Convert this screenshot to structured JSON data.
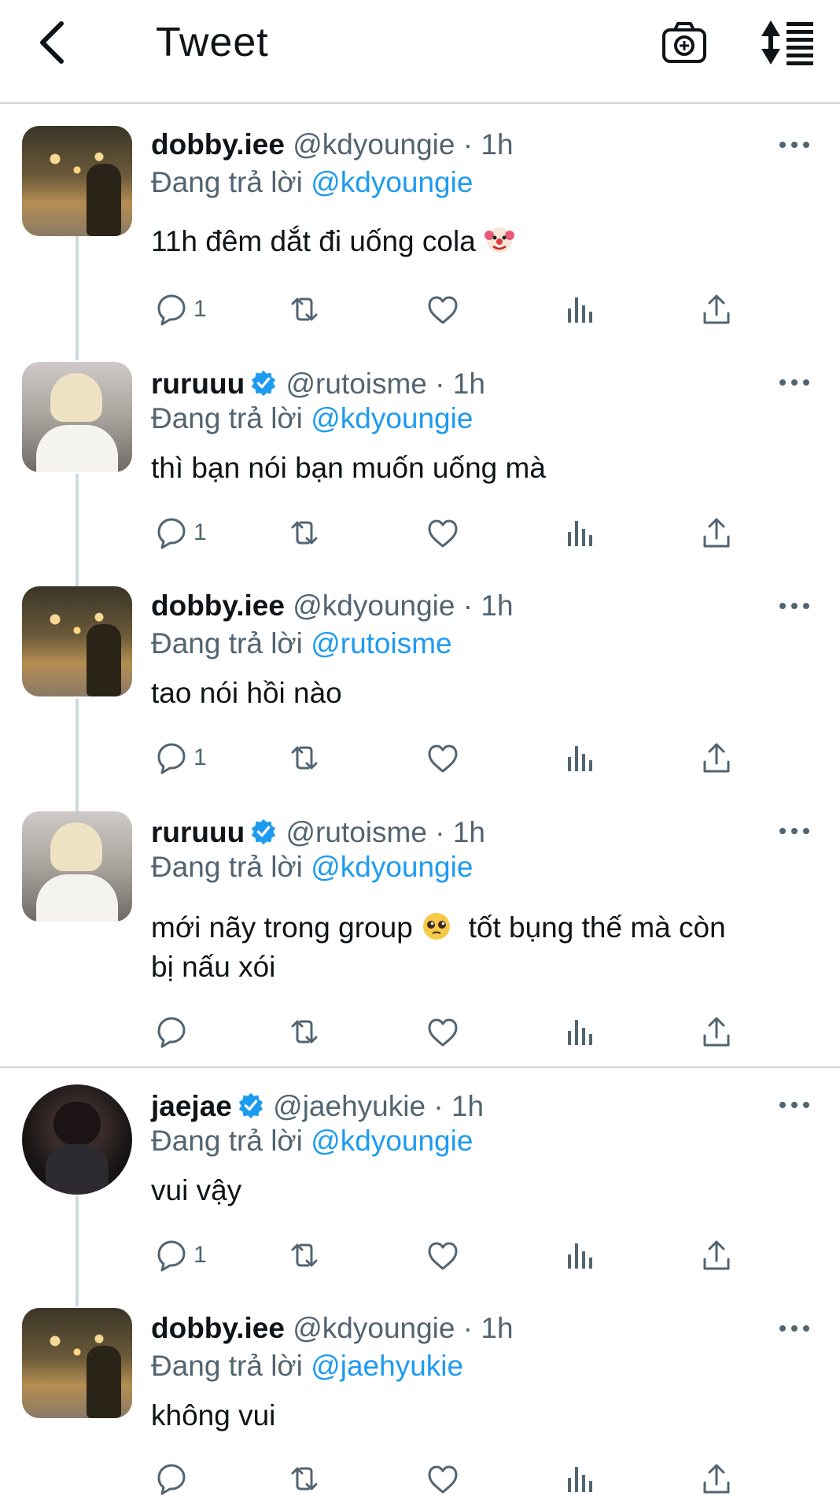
{
  "header": {
    "title": "Tweet",
    "back_icon": "back-chevron-icon",
    "camera_icon": "camera-icon",
    "sort_icon": "sort-icon"
  },
  "tweets": [
    {
      "name": "dobby.iee",
      "handle": "@kdyoungie · 1h",
      "verified": false,
      "replying_prefix": "Đang trả lời ",
      "replying_to": "@kdyoungie",
      "text": "11h đêm dắt đi uống cola",
      "emoji": "clown-emoji",
      "reply_count": "1"
    },
    {
      "name": "ruruuu",
      "handle": "@rutoisme · 1h",
      "verified": true,
      "replying_prefix": "Đang trả lời ",
      "replying_to": "@kdyoungie",
      "text": "thì bạn nói bạn muốn uống mà",
      "reply_count": "1"
    },
    {
      "name": "dobby.iee",
      "handle": "@kdyoungie · 1h",
      "verified": false,
      "replying_prefix": "Đang trả lời ",
      "replying_to": "@rutoisme",
      "text": "tao nói hồi nào",
      "reply_count": "1"
    },
    {
      "name": "ruruuu",
      "handle": "@rutoisme · 1h",
      "verified": true,
      "replying_prefix": "Đang trả lời ",
      "replying_to": "@kdyoungie",
      "text_a": "mới nãy trong group",
      "emoji": "pleading-face-emoji",
      "text_b": "tốt bụng thế mà còn",
      "text_c": "bị nấu xói",
      "reply_count": ""
    },
    {
      "name": "jaejae",
      "handle": "@jaehyukie · 1h",
      "verified": true,
      "replying_prefix": "Đang trả lời ",
      "replying_to": "@kdyoungie",
      "text": "vui vậy",
      "reply_count": "1"
    },
    {
      "name": "dobby.iee",
      "handle": "@kdyoungie · 1h",
      "verified": false,
      "replying_prefix": "Đang trả lời ",
      "replying_to": "@jaehyukie",
      "text": "không vui",
      "reply_count": ""
    }
  ],
  "colors": {
    "link": "#1d9bf0",
    "muted": "#536471",
    "verified": "#1d9bf0"
  }
}
